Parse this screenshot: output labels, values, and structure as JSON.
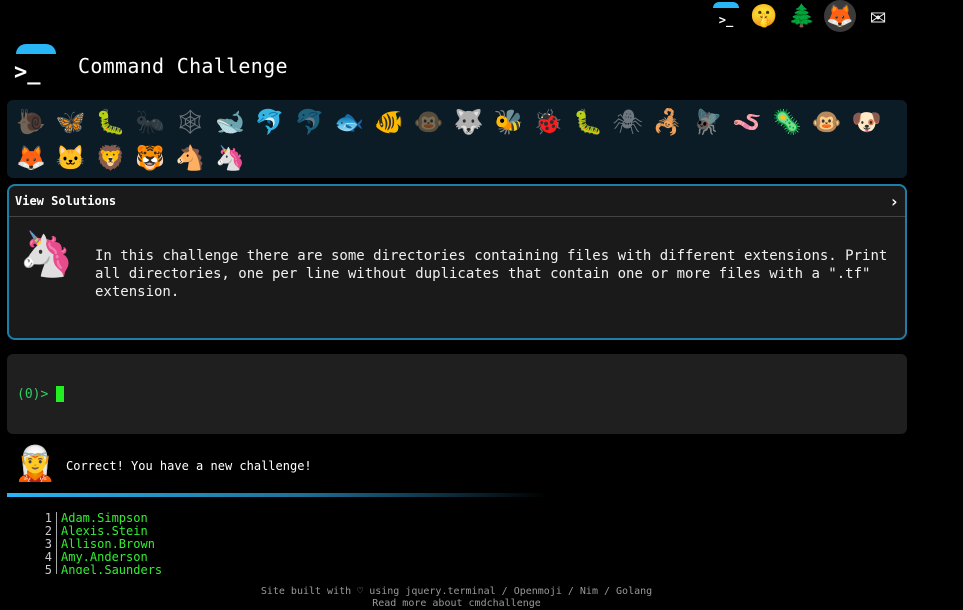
{
  "top_icons": [
    {
      "name": "cmdchallenge-logo-icon",
      "glyph": ">_"
    },
    {
      "name": "shush-face-icon",
      "glyph": "🤫"
    },
    {
      "name": "tree-icon",
      "glyph": "🌲"
    },
    {
      "name": "gitlab-icon",
      "glyph": "🦊"
    },
    {
      "name": "mail-icon",
      "glyph": "✉"
    }
  ],
  "header": {
    "title": "Command Challenge",
    "logo_glyph": ">_"
  },
  "animals": [
    {
      "name": "snail-icon",
      "glyph": "🐌",
      "dim": true
    },
    {
      "name": "butterfly-icon",
      "glyph": "🦋",
      "dim": false
    },
    {
      "name": "caterpillar-icon",
      "glyph": "🐛",
      "dim": false
    },
    {
      "name": "ant-icon",
      "glyph": "🐜",
      "dim": true
    },
    {
      "name": "spiderweb-icon",
      "glyph": "🕸",
      "dim": true
    },
    {
      "name": "whale-icon",
      "glyph": "🐋",
      "dim": false
    },
    {
      "name": "dolphin-icon",
      "glyph": "🐬",
      "dim": false
    },
    {
      "name": "dolphin-gray-icon",
      "glyph": "🐬",
      "dim": true
    },
    {
      "name": "fish-icon",
      "glyph": "🐟",
      "dim": false
    },
    {
      "name": "tropical-fish-icon",
      "glyph": "🐠",
      "dim": false
    },
    {
      "name": "monkey-face-icon",
      "glyph": "🐵",
      "dim": true
    },
    {
      "name": "wolf-icon",
      "glyph": "🐺",
      "dim": false
    },
    {
      "name": "bee-icon",
      "glyph": "🐝",
      "dim": false
    },
    {
      "name": "ladybug-icon",
      "glyph": "🐞",
      "dim": false
    },
    {
      "name": "worm-icon",
      "glyph": "🐛",
      "dim": false
    },
    {
      "name": "spider-icon",
      "glyph": "🕷",
      "dim": true
    },
    {
      "name": "scorpion-icon",
      "glyph": "🦂",
      "dim": false
    },
    {
      "name": "fly-icon",
      "glyph": "🪰",
      "dim": false
    },
    {
      "name": "worm-pink-icon",
      "glyph": "🪱",
      "dim": false
    },
    {
      "name": "microbe-icon",
      "glyph": "🦠",
      "dim": false
    },
    {
      "name": "monkey-icon",
      "glyph": "🐵",
      "dim": false
    },
    {
      "name": "dog-icon",
      "glyph": "🐶",
      "dim": false
    },
    {
      "name": "fox-icon",
      "glyph": "🦊",
      "dim": false
    },
    {
      "name": "cat-icon",
      "glyph": "🐱",
      "dim": false
    },
    {
      "name": "lion-icon",
      "glyph": "🦁",
      "dim": false
    },
    {
      "name": "tiger-icon",
      "glyph": "🐯",
      "dim": false
    },
    {
      "name": "horse-icon",
      "glyph": "🐴",
      "dim": false
    },
    {
      "name": "unicorn-icon",
      "glyph": "🦄",
      "dim": false
    }
  ],
  "challenge": {
    "view_solutions": "View Solutions",
    "chevron": "›",
    "avatar_glyph": "🦄",
    "text": "In this challenge there are some directories containing files with different extensions. Print all directories, one per line without duplicates that contain one or more files with a \".tf\" extension."
  },
  "terminal": {
    "prompt": "(0)>"
  },
  "message": {
    "avatar_glyph": "🧝",
    "text": "Correct! You have a new challenge!"
  },
  "output_lines": [
    {
      "n": "1",
      "text": "Adam.Simpson"
    },
    {
      "n": "2",
      "text": "Alexis.Stein"
    },
    {
      "n": "3",
      "text": "Allison.Brown"
    },
    {
      "n": "4",
      "text": "Amy.Anderson"
    },
    {
      "n": "5",
      "text": "Angel.Saunders"
    }
  ],
  "footer": {
    "line1": "Site built with ♡ using jquery.terminal / Openmoji / Nim / Golang",
    "line2": "Read more about cmdchallenge"
  }
}
